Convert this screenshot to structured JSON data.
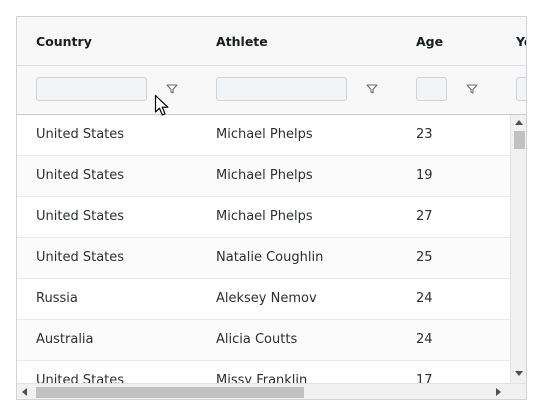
{
  "columns": [
    {
      "label": "Country"
    },
    {
      "label": "Athlete"
    },
    {
      "label": "Age"
    },
    {
      "label": "Ye"
    }
  ],
  "rows": [
    {
      "country": "United States",
      "athlete": "Michael Phelps",
      "age": "23"
    },
    {
      "country": "United States",
      "athlete": "Michael Phelps",
      "age": "19"
    },
    {
      "country": "United States",
      "athlete": "Michael Phelps",
      "age": "27"
    },
    {
      "country": "United States",
      "athlete": "Natalie Coughlin",
      "age": "25"
    },
    {
      "country": "Russia",
      "athlete": "Aleksey Nemov",
      "age": "24"
    },
    {
      "country": "Australia",
      "athlete": "Alicia Coutts",
      "age": "24"
    },
    {
      "country": "United States",
      "athlete": "Missy Franklin",
      "age": "17"
    }
  ],
  "filters": {
    "country": {
      "value": "",
      "icon": "filter-icon"
    },
    "athlete": {
      "value": "",
      "icon": "filter-icon"
    },
    "age": {
      "value": "",
      "icon": "filter-icon"
    }
  },
  "colors": {
    "header_bg": "#f8f8f8",
    "border": "#d0d3d7",
    "row_alt_bg": "#fbfbfc",
    "scrollbar_thumb": "#c1c1c1"
  }
}
